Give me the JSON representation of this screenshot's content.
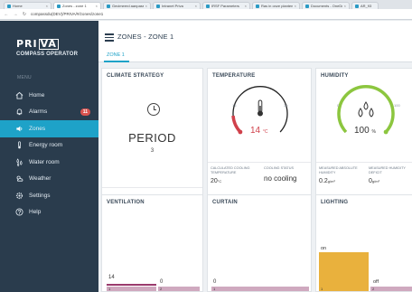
{
  "browser": {
    "tabs": [
      {
        "label": "Home"
      },
      {
        "label": "Zones - zone 1"
      },
      {
        "label": "Gecimeerd aanpassen"
      },
      {
        "label": "Intranet Priva"
      },
      {
        "label": "IRSF Parameters"
      },
      {
        "label": "Ras in onze planten"
      },
      {
        "label": "Documents - OneDrive"
      },
      {
        "label": "AR_93"
      }
    ],
    "url": "compassdu(DEV)/PRIVA/#/zones/zone1"
  },
  "sidebar": {
    "logo_text": "PRI",
    "logo_box": "VA",
    "subtitle": "COMPASS OPERATOR",
    "menu_heading": "MENU",
    "items": [
      {
        "label": "Home",
        "icon": "home-icon"
      },
      {
        "label": "Alarms",
        "icon": "bell-icon",
        "badge": "11"
      },
      {
        "label": "Zones",
        "icon": "speaker-icon",
        "active": true
      },
      {
        "label": "Energy room",
        "icon": "thermometer-icon"
      },
      {
        "label": "Water room",
        "icon": "drops-icon"
      },
      {
        "label": "Weather",
        "icon": "weather-icon"
      },
      {
        "label": "Settings",
        "icon": "gear-icon"
      },
      {
        "label": "Help",
        "icon": "help-icon"
      }
    ]
  },
  "header": {
    "title": "ZONES - ZONE 1",
    "subtab": "ZONE 1"
  },
  "panels": {
    "climate": {
      "title": "CLIMATE STRATEGY",
      "value": "PERIOD",
      "number": "3"
    },
    "temperature": {
      "title": "TEMPERATURE",
      "gauge_min": "15",
      "gauge_max": "30",
      "value": "14",
      "unit": "°C",
      "calc_label": "CALCULATED COOLING TEMPERATURE",
      "calc_value": "20",
      "calc_unit": "°C",
      "status_label": "COOLING STATUS",
      "status_value": "no cooling"
    },
    "humidity": {
      "title": "HUMIDITY",
      "gauge_min": "0",
      "gauge_max": "100",
      "value": "100",
      "unit": "%",
      "abs_label": "MEASURED ABSOLUTE HUMIDITY",
      "abs_value": "0.2",
      "abs_unit": "g/m³",
      "deficit_label": "MEASURED HUMIDITY DEFICIT",
      "deficit_value": "0",
      "deficit_unit": "g/m³"
    },
    "ventilation": {
      "title": "VENTILATION",
      "left_value": "14",
      "right_value": "0",
      "strip_left": "1",
      "strip_right": "2"
    },
    "curtain": {
      "title": "CURTAIN",
      "value": "0",
      "strip_label": "1"
    },
    "lighting": {
      "title": "LIGHTING",
      "on_label": "on",
      "off_label": "off",
      "strip_left": "1",
      "strip_right": "2"
    }
  },
  "colors": {
    "sidebar": "#2a3c4d",
    "active": "#1ea2c8",
    "temp_arc": "#d0414b",
    "humidity_arc": "#8cc63f",
    "lighting": "#e9b13d",
    "ventilation": "#9a3a6d"
  }
}
